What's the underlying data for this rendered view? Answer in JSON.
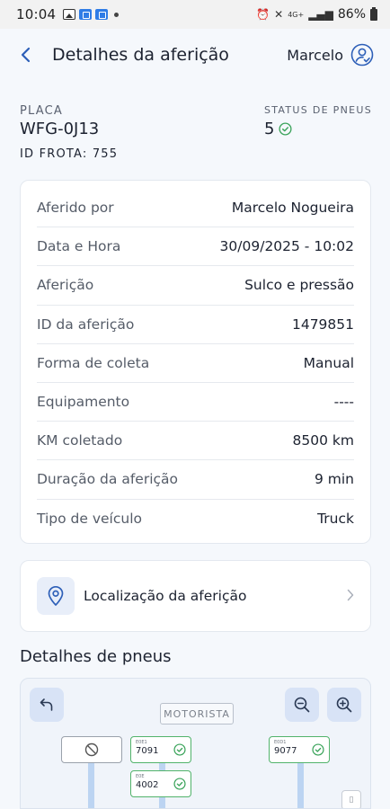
{
  "status_bar": {
    "time": "10:04",
    "battery": "86%",
    "signal": "4G+"
  },
  "header": {
    "title": "Detalhes da aferição",
    "user_name": "Marcelo"
  },
  "vehicle": {
    "plate_label": "PLACA",
    "plate_value": "WFG-0J13",
    "fleet_id": "ID FROTA: 755",
    "tire_status_label": "STATUS DE PNEUS",
    "tire_status_value": "5"
  },
  "details": [
    {
      "label": "Aferido por",
      "value": "Marcelo Nogueira"
    },
    {
      "label": "Data e Hora",
      "value": "30/09/2025 - 10:02"
    },
    {
      "label": "Aferição",
      "value": "Sulco e pressão"
    },
    {
      "label": "ID da aferição",
      "value": "1479851"
    },
    {
      "label": "Forma de coleta",
      "value": "Manual"
    },
    {
      "label": "Equipamento",
      "value": "----"
    },
    {
      "label": "KM coletado",
      "value": "8500 km"
    },
    {
      "label": "Duração da aferição",
      "value": "9 min"
    },
    {
      "label": "Tipo de veículo",
      "value": "Truck"
    }
  ],
  "location": {
    "label": "Localização da aferição"
  },
  "tires_section": {
    "title": "Detalhes de pneus",
    "driver_label": "MOTORISTA",
    "tires": [
      {
        "code": "E0E1",
        "number": "7091"
      },
      {
        "code": "E0D1",
        "number": "9077"
      },
      {
        "code": "E0E",
        "number": "4002"
      }
    ]
  },
  "colors": {
    "accent": "#2d5fb8",
    "ok_green": "#3aa35a",
    "card_bg": "#ffffff",
    "page_bg": "#f5f8fc"
  }
}
